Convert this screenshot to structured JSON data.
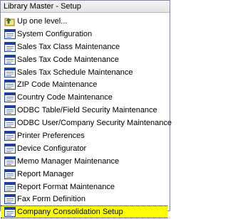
{
  "window": {
    "title": "Library Master - Setup"
  },
  "menu": {
    "items": [
      {
        "label": "Up one level...",
        "icon": "folder-up-icon",
        "selected": false
      },
      {
        "label": "System Configuration",
        "icon": "program-icon",
        "selected": false
      },
      {
        "label": "Sales Tax Class Maintenance",
        "icon": "program-icon",
        "selected": false
      },
      {
        "label": "Sales Tax Code Maintenance",
        "icon": "program-icon",
        "selected": false
      },
      {
        "label": "Sales Tax Schedule Maintenance",
        "icon": "program-icon",
        "selected": false
      },
      {
        "label": "ZIP Code Maintenance",
        "icon": "program-icon",
        "selected": false
      },
      {
        "label": "Country Code Maintenance",
        "icon": "program-icon",
        "selected": false
      },
      {
        "label": "ODBC Table/Field Security Maintenance",
        "icon": "program-icon",
        "selected": false
      },
      {
        "label": "ODBC User/Company Security Maintenance",
        "icon": "program-icon",
        "selected": false
      },
      {
        "label": "Printer Preferences",
        "icon": "program-icon",
        "selected": false
      },
      {
        "label": "Device Configurator",
        "icon": "program-icon",
        "selected": false
      },
      {
        "label": "Memo Manager Maintenance",
        "icon": "program-icon",
        "selected": false
      },
      {
        "label": "Report Manager",
        "icon": "program-icon",
        "selected": false
      },
      {
        "label": "Report Format Maintenance",
        "icon": "program-icon",
        "selected": false
      },
      {
        "label": "Fax Form Definition",
        "icon": "program-icon",
        "selected": false
      },
      {
        "label": "Company Consolidation Setup",
        "icon": "program-icon",
        "selected": true
      }
    ]
  },
  "colors": {
    "selected_bg": "#ffff00",
    "icon_blue": "#1f3f9f"
  }
}
